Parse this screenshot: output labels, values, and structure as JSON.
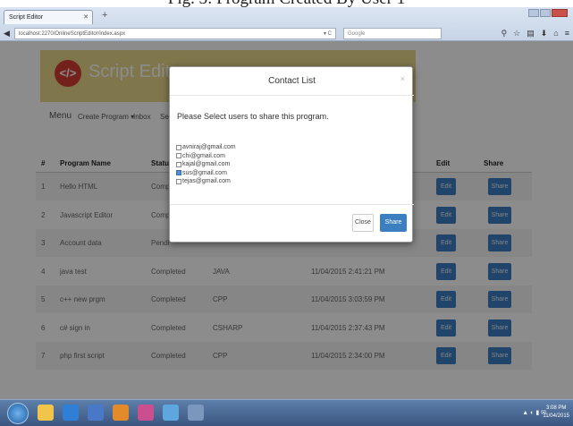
{
  "caption": "Fig. 3: Program Created By User 1",
  "browser": {
    "tab_title": "Script Editor",
    "url": "localhost:2270/OnlineScriptEditor/index.aspx",
    "search_placeholder": "Google"
  },
  "app": {
    "brand": "Script Editor",
    "menu": [
      "Menu",
      "Create Program ▾",
      "Inbox",
      "Se"
    ]
  },
  "table": {
    "headers": [
      "#",
      "Program Name",
      "Status",
      "Edit",
      "Share"
    ],
    "rows": [
      {
        "num": "1",
        "name": "Hello HTML",
        "status": "Comp",
        "lang": "",
        "date": "",
        "edit": "Edit",
        "share": "Share"
      },
      {
        "num": "2",
        "name": "Javascript Editor",
        "status": "Comp",
        "lang": "",
        "date": "",
        "edit": "Edit",
        "share": "Share"
      },
      {
        "num": "3",
        "name": "Account data",
        "status": "Pendi",
        "lang": "",
        "date": "",
        "edit": "Edit",
        "share": "Share"
      },
      {
        "num": "4",
        "name": "java test",
        "status": "Completed",
        "lang": "JAVA",
        "date": "11/04/2015 2:41:21 PM",
        "edit": "Edit",
        "share": "Share"
      },
      {
        "num": "5",
        "name": "c++ new prgm",
        "status": "Completed",
        "lang": "CPP",
        "date": "11/04/2015 3:03:59 PM",
        "edit": "Edit",
        "share": "Share"
      },
      {
        "num": "6",
        "name": "c# sign in",
        "status": "Completed",
        "lang": "CSHARP",
        "date": "11/04/2015 2:37:43 PM",
        "edit": "Edit",
        "share": "Share"
      },
      {
        "num": "7",
        "name": "php first script",
        "status": "Completed",
        "lang": "CPP",
        "date": "11/04/2015 2:34:00 PM",
        "edit": "Edit",
        "share": "Share"
      }
    ]
  },
  "modal": {
    "title": "Contact List",
    "close_x": "×",
    "message": "Please Select users to share this program.",
    "contacts": [
      {
        "email": "avniraj@gmail.com",
        "checked": false
      },
      {
        "email": "chi@gmail.com",
        "checked": false
      },
      {
        "email": "kajal@gmail.com",
        "checked": false
      },
      {
        "email": "sus@gmail.com",
        "checked": true
      },
      {
        "email": "tejas@gmail.com",
        "checked": false
      }
    ],
    "close_label": "Close",
    "share_label": "Share"
  },
  "taskbar": {
    "time": "3:08 PM",
    "date": "11/04/2015"
  }
}
